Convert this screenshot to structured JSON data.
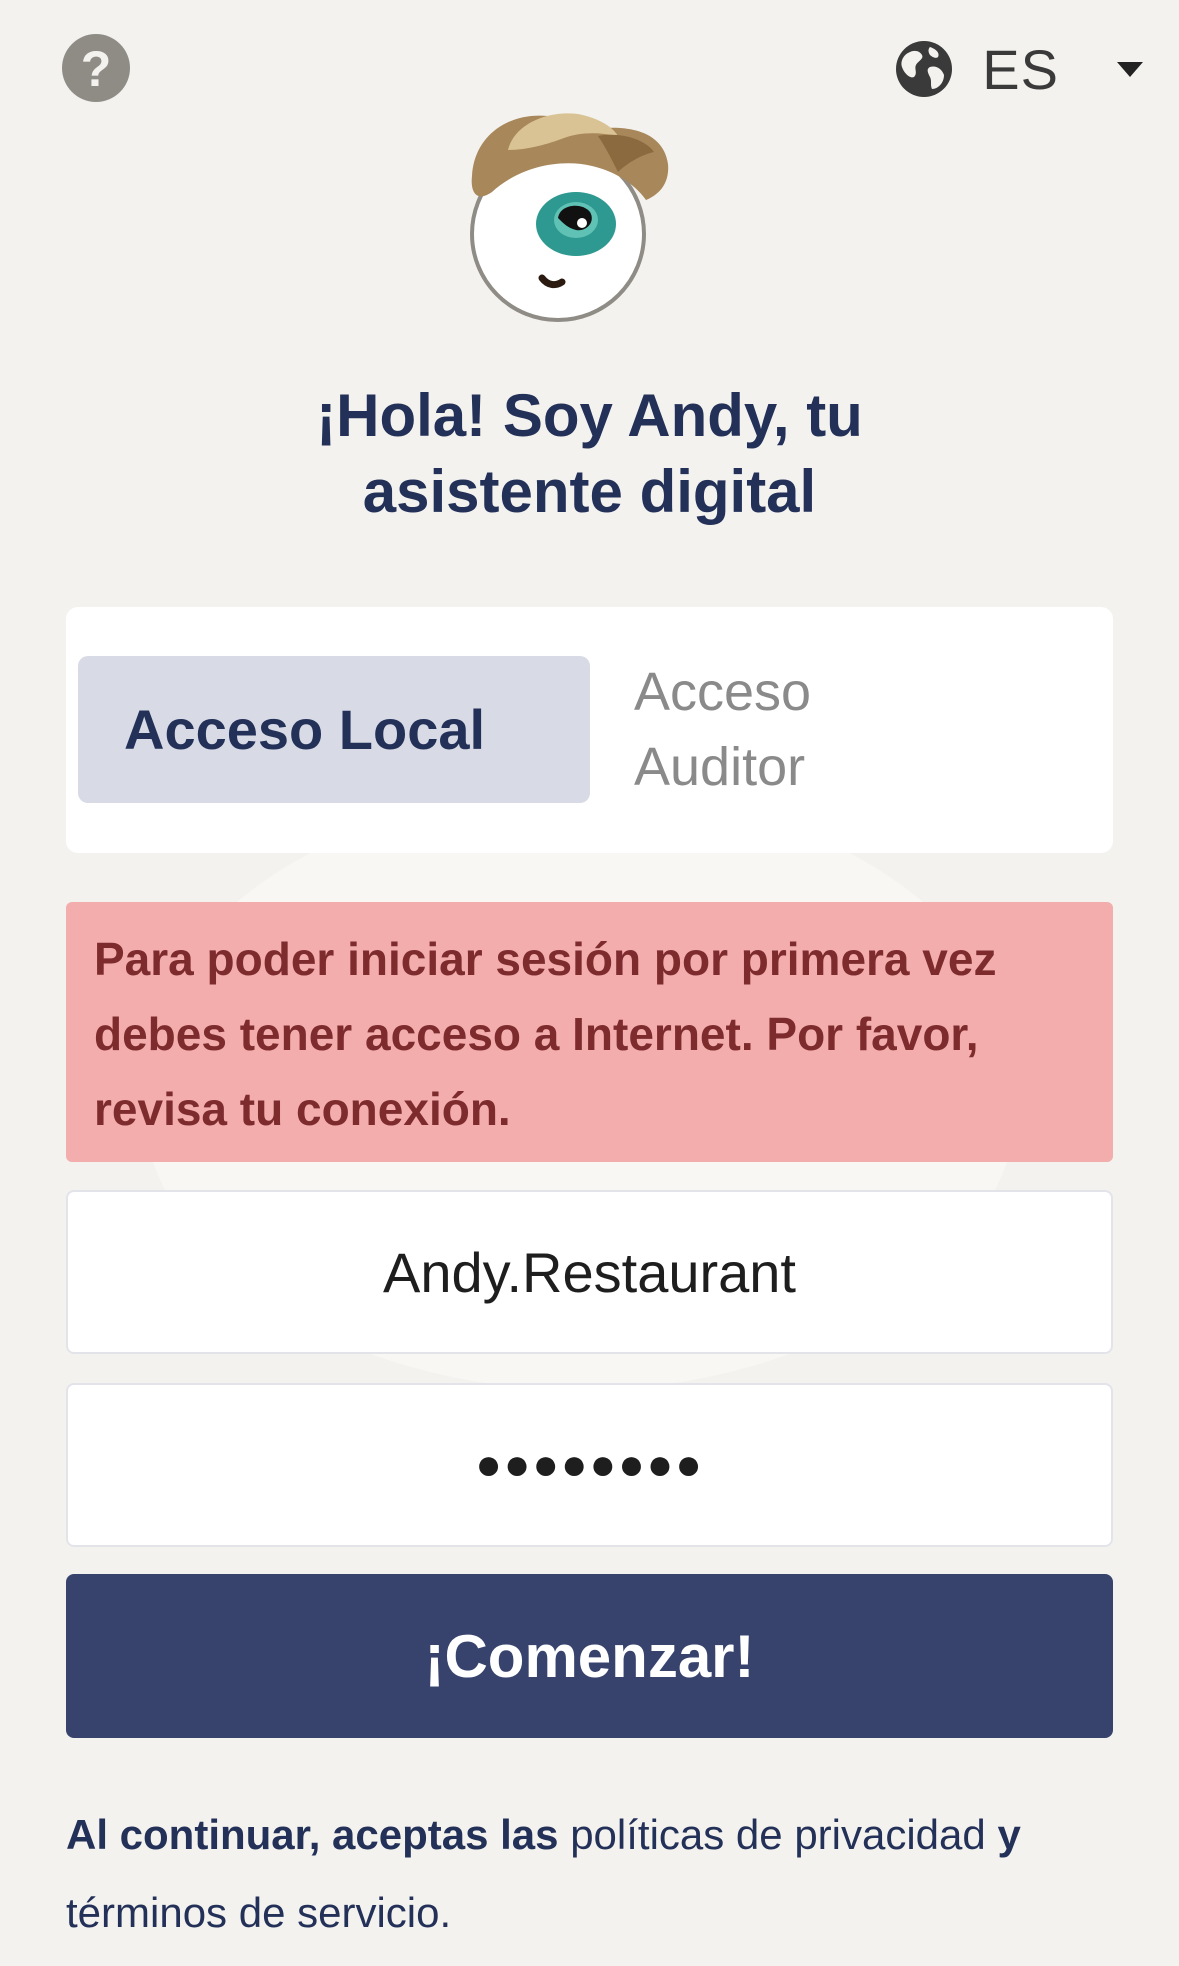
{
  "header": {
    "help_icon_glyph": "?",
    "language_code": "ES"
  },
  "greeting": {
    "line1": "¡Hola! Soy Andy, tu",
    "line2": "asistente digital"
  },
  "tabs": {
    "local_label": "Acceso Local",
    "auditor_label": "Acceso Auditor",
    "active": "local"
  },
  "alert": {
    "message": "Para poder iniciar sesión por primera vez debes tener acceso a Internet. Por favor, revisa tu conexión."
  },
  "form": {
    "username_value": "Andy.Restaurant",
    "password_mask": "●●●●●●●●",
    "submit_label": "¡Comenzar!"
  },
  "legal": {
    "prefix": "Al continuar, aceptas las",
    "privacy_link": "políticas de privacidad",
    "connector": "y",
    "terms_link": "términos de servicio."
  },
  "colors": {
    "background": "#f3f2ee",
    "primary": "#37436d",
    "title": "#233058",
    "alert_bg": "#f2adac",
    "alert_text": "#7e2b2e",
    "active_tab_bg": "#d8dbe5"
  },
  "icons": {
    "help": "question-circle-icon",
    "language": "globe-icon",
    "dropdown": "caret-down-icon",
    "mascot": "andy-mascot"
  }
}
